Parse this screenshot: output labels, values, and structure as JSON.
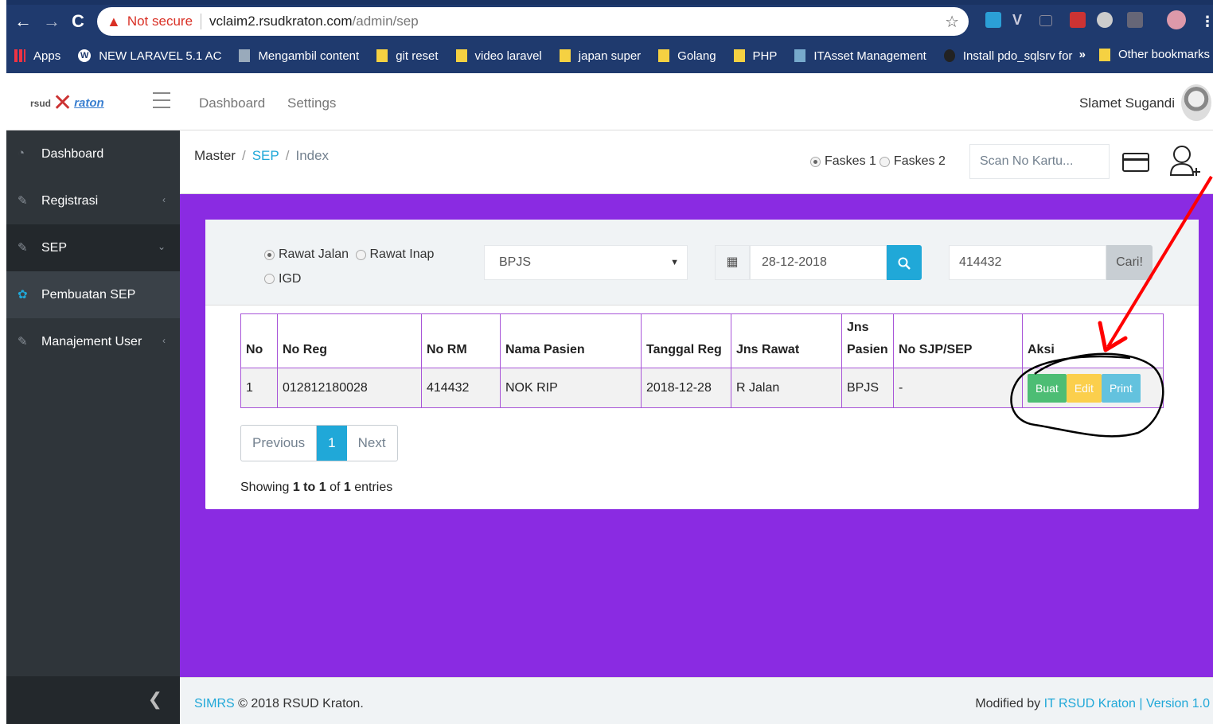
{
  "browser": {
    "security_label": "Not secure",
    "url_host": "vclaim2.rsudkraton.com",
    "url_path": "/admin/sep",
    "bookmarks": [
      {
        "label": "Apps",
        "icon": "apps-grid-icon"
      },
      {
        "label": "NEW LARAVEL 5.1 AC",
        "icon": "wordpress-icon"
      },
      {
        "label": "Mengambil content",
        "icon": "page-icon"
      },
      {
        "label": "git reset",
        "icon": "folder-icon"
      },
      {
        "label": "video laravel",
        "icon": "folder-icon"
      },
      {
        "label": "japan super",
        "icon": "folder-icon"
      },
      {
        "label": "Golang",
        "icon": "folder-icon"
      },
      {
        "label": "PHP",
        "icon": "folder-icon"
      },
      {
        "label": "ITAsset Management",
        "icon": "page-icon"
      },
      {
        "label": "Install pdo_sqlsrv for",
        "icon": "github-icon"
      }
    ],
    "more": "»",
    "other_bookmarks": "Other bookmarks"
  },
  "header": {
    "logo_prefix": "rsud",
    "logo_name": "raton",
    "nav": [
      "Dashboard",
      "Settings"
    ],
    "user_name": "Slamet Sugandi"
  },
  "sidebar": {
    "items": [
      {
        "label": "Dashboard",
        "caret": ""
      },
      {
        "label": "Registrasi",
        "caret": "‹"
      },
      {
        "label": "SEP",
        "caret": "⌄"
      },
      {
        "label": "Pembuatan SEP",
        "caret": ""
      },
      {
        "label": "Manajement User",
        "caret": "‹"
      }
    ]
  },
  "breadcrumb": {
    "root": "Master",
    "link": "SEP",
    "current": "Index"
  },
  "faskes": {
    "option1": "Faskes 1",
    "option2": "Faskes 2"
  },
  "scan": {
    "placeholder": "Scan No Kartu..."
  },
  "filter": {
    "rawat_jalan": "Rawat Jalan",
    "rawat_inap": "Rawat Inap",
    "igd": "IGD",
    "payer": "BPJS",
    "date": "28-12-2018",
    "no_rm": "414432",
    "cari": "Cari!"
  },
  "table": {
    "headers": [
      "No",
      "No Reg",
      "No RM",
      "Nama Pasien",
      "Tanggal Reg",
      "Jns Rawat",
      "Jns Pasien",
      "No SJP/SEP",
      "Aksi"
    ],
    "rows": [
      [
        "1",
        "012812180028",
        "414432",
        "NOK RIP",
        "2018-12-28",
        "R Jalan",
        "BPJS",
        "-"
      ]
    ],
    "actions": {
      "buat": "Buat",
      "edit": "Edit",
      "print": "Print"
    }
  },
  "pagination": {
    "previous": "Previous",
    "page": "1",
    "next": "Next"
  },
  "showing": {
    "prefix": "Showing ",
    "range": "1 to 1",
    "middle": " of ",
    "total": "1",
    "suffix": " entries"
  },
  "footer": {
    "app": "SIMRS",
    "copyright": " © 2018 RSUD Kraton.",
    "modified_by": "Modified by ",
    "team": "IT RSUD Kraton",
    "version": " | Version 1.0"
  },
  "colors": {
    "accent": "#20a8d8",
    "content_bg": "#8a2be2",
    "sidebar_bg": "#2f353a",
    "annotation": "#ff0000"
  }
}
